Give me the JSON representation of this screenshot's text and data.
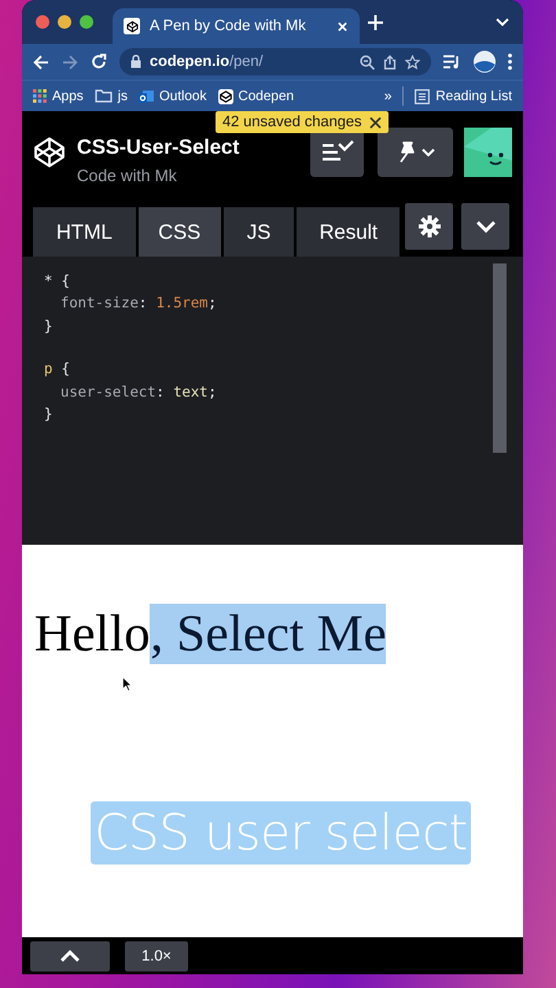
{
  "browser": {
    "tabs": [
      {
        "title": "A Pen by Code with Mk",
        "selected": true
      }
    ],
    "url": {
      "host": "codepen.io",
      "path": "/pen/"
    },
    "bookmarks": [
      {
        "label": "Apps",
        "kind": "apps"
      },
      {
        "label": "js",
        "kind": "folder"
      },
      {
        "label": "Outlook",
        "kind": "outlook"
      },
      {
        "label": "Codepen",
        "kind": "codepen"
      }
    ],
    "overflow": "»",
    "reading_list": "Reading List"
  },
  "pen": {
    "title": "CSS-User-Select",
    "author": "Code with Mk",
    "unsaved_badge": "42 unsaved changes"
  },
  "editor": {
    "tabs": [
      {
        "label": "HTML",
        "selected": false
      },
      {
        "label": "CSS",
        "selected": true
      },
      {
        "label": "JS",
        "selected": false
      },
      {
        "label": "Result",
        "selected": false
      }
    ],
    "blocks": [
      [
        {
          "indent": false,
          "tokens": [
            {
              "text": "*",
              "kind": "universal"
            },
            {
              "text": " {",
              "kind": "punct"
            }
          ]
        },
        {
          "indent": true,
          "tokens": [
            {
              "text": "font-size",
              "kind": "property"
            },
            {
              "text": ": ",
              "kind": "punct"
            },
            {
              "text": "1.5rem",
              "kind": "number"
            },
            {
              "text": ";",
              "kind": "punct"
            }
          ]
        },
        {
          "indent": false,
          "tokens": [
            {
              "text": "}",
              "kind": "punct"
            }
          ]
        }
      ],
      [
        {
          "indent": false,
          "tokens": [
            {
              "text": "p",
              "kind": "tag"
            },
            {
              "text": " {",
              "kind": "punct"
            }
          ]
        },
        {
          "indent": true,
          "tokens": [
            {
              "text": "user-select",
              "kind": "property"
            },
            {
              "text": ": ",
              "kind": "punct"
            },
            {
              "text": "text",
              "kind": "keyword"
            },
            {
              "text": ";",
              "kind": "punct"
            }
          ]
        },
        {
          "indent": false,
          "tokens": [
            {
              "text": "}",
              "kind": "punct"
            }
          ]
        }
      ]
    ]
  },
  "result": {
    "segments": [
      {
        "text": "Hello",
        "selected": false
      },
      {
        "text": ", Select Me",
        "selected": true
      }
    ],
    "caption": "CSS user select"
  },
  "bottom_bar": {
    "zoom": "1.0×"
  }
}
